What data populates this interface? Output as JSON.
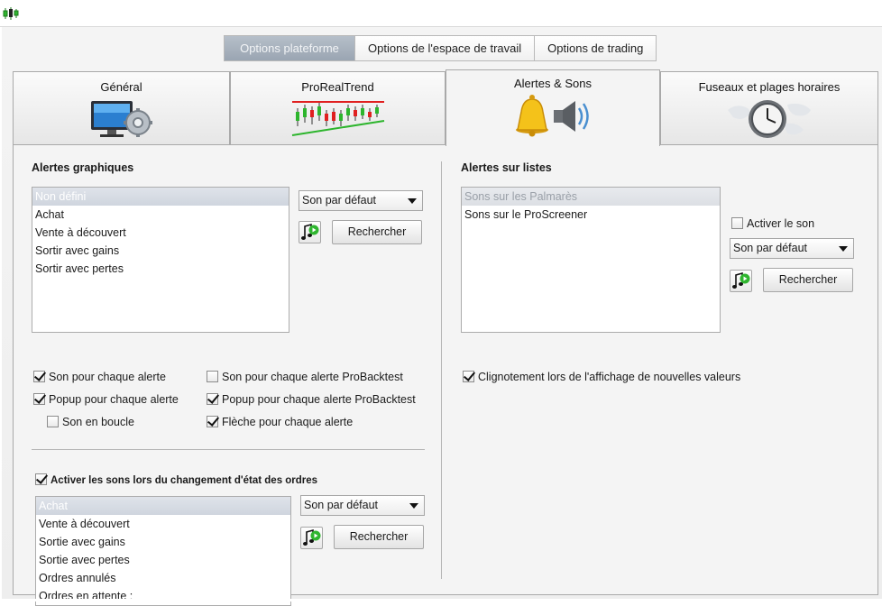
{
  "top_tabs": [
    "Options plateforme",
    "Options de l'espace de travail",
    "Options de trading"
  ],
  "tabs": [
    {
      "label": "Général",
      "icon": "monitor-gear-icon"
    },
    {
      "label": "ProRealTrend",
      "icon": "candlestick-trend-icon"
    },
    {
      "label": "Alertes & Sons",
      "icon": "bell-speaker-icon"
    },
    {
      "label": "Fuseaux et plages horaires",
      "icon": "clock-world-icon"
    }
  ],
  "left": {
    "title": "Alertes graphiques",
    "list": [
      "Non défini",
      "Achat",
      "Vente à découvert",
      "Sortir avec gains",
      "Sortir avec pertes"
    ],
    "combo": "Son par défaut",
    "search": "Rechercher",
    "checks": [
      {
        "label": "Son pour chaque alerte",
        "checked": true
      },
      {
        "label": "Son pour chaque alerte ProBacktest",
        "checked": false
      },
      {
        "label": "Popup pour chaque alerte",
        "checked": true
      },
      {
        "label": "Popup pour chaque alerte ProBacktest",
        "checked": true
      },
      {
        "label": "Son en boucle",
        "checked": false
      },
      {
        "label": "Flèche pour chaque alerte",
        "checked": true
      }
    ]
  },
  "orders": {
    "check_label": "Activer les sons lors du changement d'état des ordres",
    "list": [
      "Achat",
      "Vente à découvert",
      "Sortie avec gains",
      "Sortie avec pertes",
      "Ordres annulés",
      "Ordres en attente :"
    ],
    "combo": "Son par défaut",
    "search": "Rechercher"
  },
  "right": {
    "title": "Alertes sur listes",
    "list": [
      "Sons sur les Palmarès",
      "Sons sur le ProScreener"
    ],
    "activate": "Activer le son",
    "combo": "Son par défaut",
    "search": "Rechercher",
    "blink": "Clignotement lors de l'affichage de nouvelles valeurs"
  }
}
